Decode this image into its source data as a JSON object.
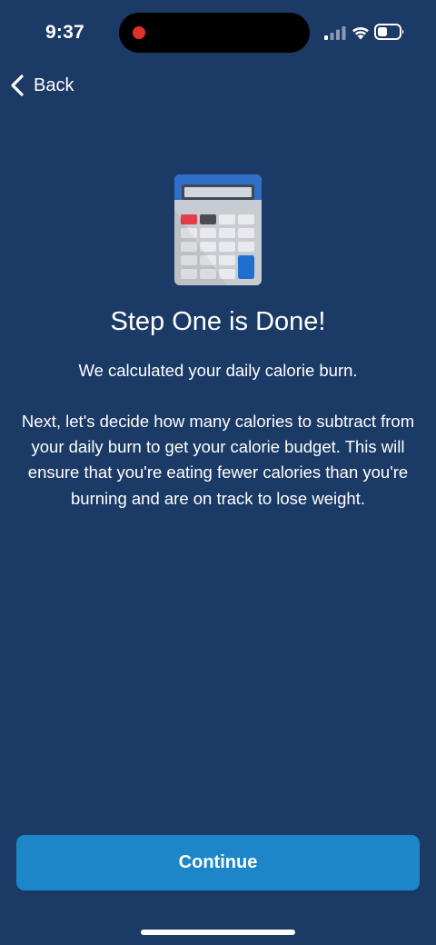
{
  "status_bar": {
    "time": "9:37"
  },
  "nav": {
    "back_label": "Back"
  },
  "content": {
    "title": "Step One is Done!",
    "subtitle": "We calculated your daily calorie burn.",
    "body": "Next, let's decide how many calories to subtract from your daily burn to get your calorie budget. This will ensure that you're eating fewer calories than you're burning and are on track to lose weight."
  },
  "footer": {
    "continue_label": "Continue"
  },
  "icons": {
    "hero": "calculator-icon",
    "back": "chevron-left-icon",
    "recording": "recording-dot-icon",
    "signal": "cellular-signal-icon",
    "wifi": "wifi-icon",
    "battery": "battery-icon"
  },
  "colors": {
    "background": "#1b3a66",
    "button": "#1c86c9",
    "text": "#ffffff",
    "recording": "#e0302a"
  }
}
